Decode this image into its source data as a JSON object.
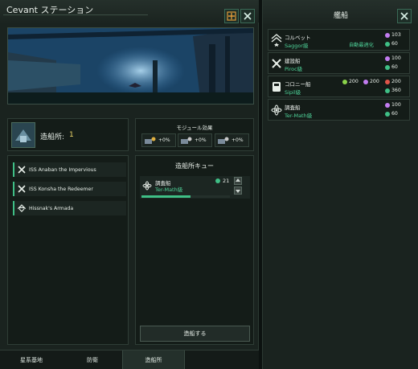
{
  "window": {
    "title": "Cevant ステーション"
  },
  "shipyard": {
    "label": "造船所:",
    "count": "1"
  },
  "modules": {
    "title": "モジュール効果",
    "slots": [
      {
        "value": "+0%"
      },
      {
        "value": "+0%"
      },
      {
        "value": "+0%"
      }
    ]
  },
  "ships_list": {
    "items": [
      {
        "label": "ISS Anaban the Impervious",
        "icon": "wrench-cross-icon"
      },
      {
        "label": "ISS Konsha the Redeemer",
        "icon": "wrench-cross-icon"
      },
      {
        "label": "Hissnak's Armada",
        "icon": "armada-icon"
      }
    ]
  },
  "queue": {
    "title": "造船所キュー",
    "item": {
      "name": "調査船",
      "class": "Ter-Math級",
      "days": "21",
      "progress": 0.55
    },
    "build_button": "造船する"
  },
  "tabs": [
    {
      "label": "星系基地"
    },
    {
      "label": "防衛"
    },
    {
      "label": "造船所"
    }
  ],
  "fleet_panel": {
    "title": "艦船",
    "ships": [
      {
        "name": "コルベット",
        "class": "Saggor級",
        "note": "自動最適化",
        "alloy": "103",
        "energy": "60",
        "icon": "corvette-icon"
      },
      {
        "name": "建設船",
        "class": "Piroc級",
        "alloy": "100",
        "energy": "60",
        "icon": "construction-icon"
      },
      {
        "name": "コロニー船",
        "class": "Sipil級",
        "food": "200",
        "alloy": "200",
        "consumer": "200",
        "energy": "360",
        "icon": "colony-icon"
      },
      {
        "name": "調査船",
        "class": "Ter-Math級",
        "alloy": "100",
        "energy": "60",
        "icon": "science-icon"
      }
    ]
  },
  "colors": {
    "accent": "#3fbf86",
    "count_yellow": "#f0d86a",
    "class_green": "#4fd49a",
    "alloy_purple": "#c27cf0",
    "energy_green": "#3fbf86"
  }
}
